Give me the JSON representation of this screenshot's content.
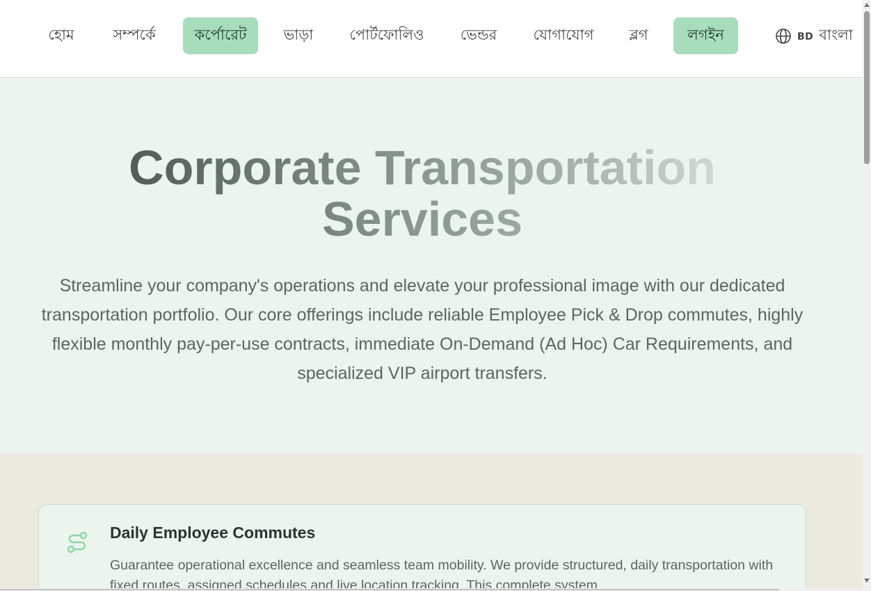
{
  "nav": {
    "items": [
      {
        "label": "হোম",
        "active": false
      },
      {
        "label": "সম্পর্কে",
        "active": false
      },
      {
        "label": "কর্পোরেট",
        "active": true
      },
      {
        "label": "ভাড়া",
        "active": false
      },
      {
        "label": "পোর্টফোলিও",
        "active": false
      },
      {
        "label": "ভেন্ডর",
        "active": false
      },
      {
        "label": "যোগাযোগ",
        "active": false
      },
      {
        "label": "ব্লগ",
        "active": false
      },
      {
        "label": "লগইন",
        "active": true
      }
    ],
    "language": {
      "icon": "globe-icon",
      "country_code": "BD",
      "label": "বাংলা"
    }
  },
  "hero": {
    "title_line1": "Corporate Transportation",
    "title_line2": "Services",
    "description": "Streamline your company's operations and elevate your professional image with our dedicated transportation portfolio. Our core offerings include reliable Employee Pick & Drop commutes, highly flexible monthly pay-per-use contracts, immediate On-Demand (Ad Hoc) Car Requirements, and specialized VIP airport transfers."
  },
  "services": {
    "cards": [
      {
        "icon": "route-icon",
        "title": "Daily Employee Commutes",
        "text": "Guarantee operational excellence and seamless team mobility. We provide structured, daily transportation with fixed routes, assigned schedules and live location tracking. This complete system"
      }
    ]
  },
  "colors": {
    "accent": "#a8dcbd",
    "hero_bg": "#ebf5ed",
    "section_bg": "#eaeadf",
    "icon": "#8fd3a8"
  }
}
